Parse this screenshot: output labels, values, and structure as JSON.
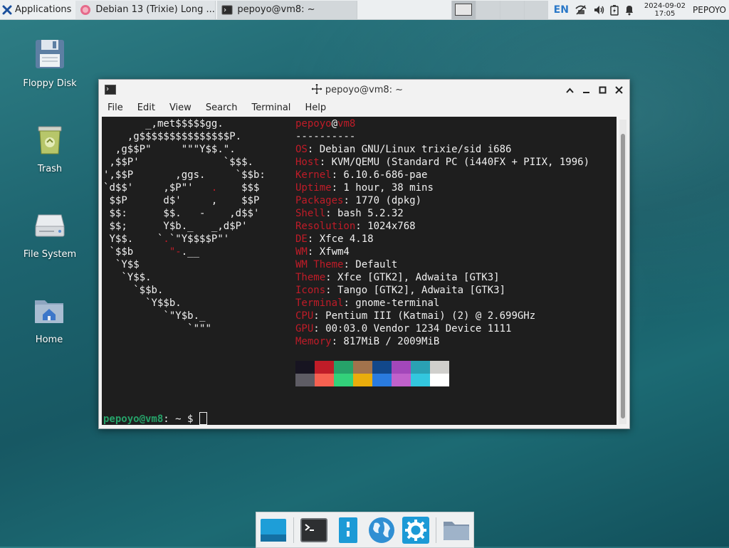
{
  "top_panel": {
    "applications_label": "Applications",
    "tasks": [
      {
        "label": "Debian 13 (Trixie) Long ...",
        "icon": "firefox-icon"
      },
      {
        "label": "pepoyo@vm8: ~",
        "icon": "terminal-icon"
      }
    ],
    "keyboard_layout": "EN",
    "clock_date": "2024-09-02",
    "clock_time": "17:05",
    "user": "PEPOYO"
  },
  "desktop_icons": [
    {
      "label": "Floppy Disk",
      "icon": "floppy-disk-icon"
    },
    {
      "label": "Trash",
      "icon": "trash-icon"
    },
    {
      "label": "File System",
      "icon": "drive-icon"
    },
    {
      "label": "Home",
      "icon": "home-folder-icon"
    }
  ],
  "terminal": {
    "title": "pepoyo@vm8: ~",
    "menu": [
      "File",
      "Edit",
      "View",
      "Search",
      "Terminal",
      "Help"
    ],
    "ascii_logo": [
      "       _,met$$$$$gg.",
      "    ,g$$$$$$$$$$$$$$$P.",
      "  ,g$$P\"     \"\"\"Y$$.\".",
      " ,$$P'              `$$$.",
      "',$$P       ,ggs.     `$$b:",
      "`d$$'     ,$P\"'   .    $$$",
      " $$P      d$'     ,    $$P",
      " $$:      $$.   -    ,d$$'",
      " $$;      Y$b._   _,d$P'",
      " Y$$.    `.`\"Y$$$$P\"'",
      " `$$b      \"-.__",
      "  `Y$$",
      "   `Y$$.",
      "     `$$b.",
      "       `Y$$b.",
      "          `\"Y$b._",
      "              `\"\"\""
    ],
    "user": "pepoyo",
    "host": "vm8",
    "separator": "----------",
    "info": [
      {
        "label": "OS",
        "value": "Debian GNU/Linux trixie/sid i686"
      },
      {
        "label": "Host",
        "value": "KVM/QEMU (Standard PC (i440FX + PIIX, 1996)"
      },
      {
        "label": "Kernel",
        "value": "6.10.6-686-pae"
      },
      {
        "label": "Uptime",
        "value": "1 hour, 38 mins"
      },
      {
        "label": "Packages",
        "value": "1770 (dpkg)"
      },
      {
        "label": "Shell",
        "value": "bash 5.2.32"
      },
      {
        "label": "Resolution",
        "value": "1024x768"
      },
      {
        "label": "DE",
        "value": "Xfce 4.18"
      },
      {
        "label": "WM",
        "value": "Xfwm4"
      },
      {
        "label": "WM Theme",
        "value": "Default"
      },
      {
        "label": "Theme",
        "value": "Xfce [GTK2], Adwaita [GTK3]"
      },
      {
        "label": "Icons",
        "value": "Tango [GTK2], Adwaita [GTK3]"
      },
      {
        "label": "Terminal",
        "value": "gnome-terminal"
      },
      {
        "label": "CPU",
        "value": "Pentium III (Katmai) (2) @ 2.699GHz"
      },
      {
        "label": "GPU",
        "value": "00:03.0 Vendor 1234 Device 1111"
      },
      {
        "label": "Memory",
        "value": "817MiB / 2009MiB"
      }
    ],
    "palette_dark": [
      "#171421",
      "#c01c28",
      "#26a269",
      "#a2734c",
      "#12488b",
      "#a347ba",
      "#2aa1b3",
      "#d0cfcc"
    ],
    "palette_bright": [
      "#5e5c64",
      "#f66151",
      "#33d17a",
      "#e9ad0c",
      "#2a7bde",
      "#c061cb",
      "#33c7de",
      "#ffffff"
    ],
    "prompt_user": "pepoyo@vm8",
    "prompt_rest": ": ~ $ "
  },
  "dock": [
    {
      "icon": "show-desktop-icon"
    },
    {
      "icon": "terminal-icon"
    },
    {
      "icon": "file-manager-icon"
    },
    {
      "icon": "web-browser-icon"
    },
    {
      "icon": "settings-gear-icon"
    },
    {
      "icon": "folder-icon"
    }
  ]
}
